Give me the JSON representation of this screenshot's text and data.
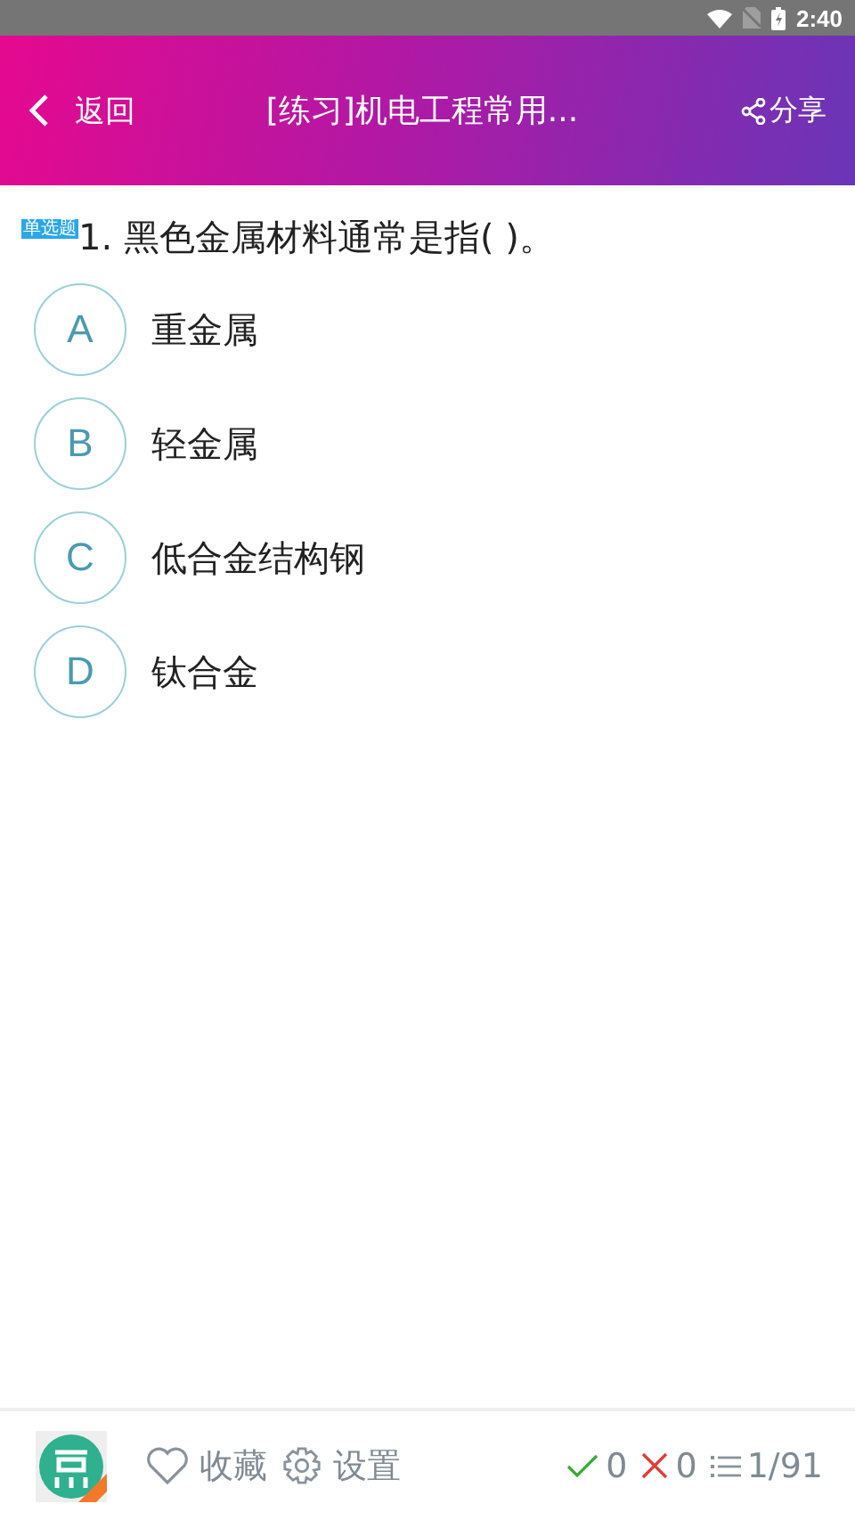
{
  "status_bar": {
    "time": "2:40"
  },
  "header": {
    "back_label": "返回",
    "title": "[练习]机电工程常用...",
    "share_label": "分享"
  },
  "question": {
    "type_badge": "单选题",
    "text": "1. 黑色金属材料通常是指( )。"
  },
  "options": [
    {
      "letter": "A",
      "text": "重金属",
      "selected": false
    },
    {
      "letter": "B",
      "text": "轻金属",
      "selected": false
    },
    {
      "letter": "C",
      "text": "低合金结构钢",
      "selected": false
    },
    {
      "letter": "D",
      "text": "钛合金",
      "selected": false
    }
  ],
  "footer": {
    "favorite_label": "收藏",
    "settings_label": "设置",
    "correct_count": "0",
    "wrong_count": "0",
    "progress": "1/91"
  }
}
